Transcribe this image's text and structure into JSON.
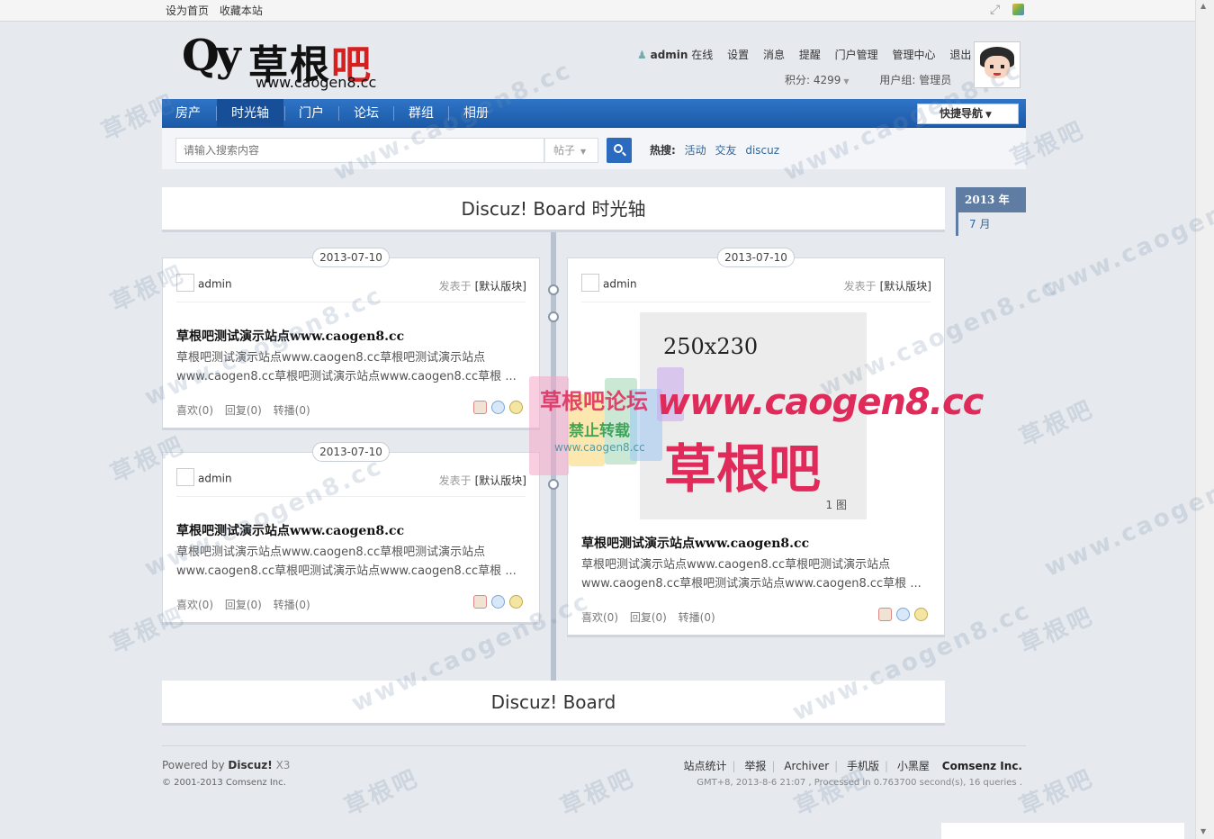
{
  "topbar": {
    "set_home": "设为首页",
    "bookmark": "收藏本站",
    "fullscreen_icon": "fullscreen-icon",
    "app_icon": "app-icon"
  },
  "logo": {
    "script": "Qy",
    "name_left": "草根",
    "name_right": "吧",
    "url": "www.caogen8.cc"
  },
  "user": {
    "name": "admin",
    "status": "在线",
    "settings": "设置",
    "messages": "消息",
    "reminders": "提醒",
    "portal_manage": "门户管理",
    "admin_center": "管理中心",
    "logout": "退出",
    "points": "积分: 4299",
    "group": "用户组: 管理员"
  },
  "nav": {
    "tabs": [
      {
        "label": "房产"
      },
      {
        "label": "时光轴"
      },
      {
        "label": "门户"
      },
      {
        "label": "论坛"
      },
      {
        "label": "群组"
      },
      {
        "label": "相册"
      }
    ],
    "active_index": 1,
    "quick_nav": "快捷导航"
  },
  "search": {
    "placeholder": "请输入搜索内容",
    "type": "帖子",
    "hot_label": "热搜:",
    "hot_keywords": [
      "活动",
      "交友",
      "discuz"
    ]
  },
  "timeline": {
    "title": "Discuz! Board 时光轴",
    "year": "2013 年",
    "month": "7 月",
    "posts": [
      {
        "date": "2013-07-10",
        "author": "admin",
        "posted_in": "发表于",
        "forum": "[默认版块]",
        "title": "草根吧测试演示站点www.caogen8.cc",
        "excerpt": "草根吧测试演示站点www.caogen8.cc草根吧测试演示站点www.caogen8.cc草根吧测试演示站点www.caogen8.cc草根 ...",
        "likes": "喜欢(0)",
        "replies": "回复(0)",
        "forwards": "转播(0)"
      },
      {
        "date": "2013-07-10",
        "author": "admin",
        "posted_in": "发表于",
        "forum": "[默认版块]",
        "title": "草根吧测试演示站点www.caogen8.cc",
        "excerpt": "草根吧测试演示站点www.caogen8.cc草根吧测试演示站点www.caogen8.cc草根吧测试演示站点www.caogen8.cc草根 ...",
        "likes": "喜欢(0)",
        "replies": "回复(0)",
        "forwards": "转播(0)"
      },
      {
        "date": "2013-07-10",
        "author": "admin",
        "posted_in": "发表于",
        "forum": "[默认版块]",
        "image_label": "250x230",
        "image_count": "1 图",
        "title": "草根吧测试演示站点www.caogen8.cc",
        "excerpt": "草根吧测试演示站点www.caogen8.cc草根吧测试演示站点www.caogen8.cc草根吧测试演示站点www.caogen8.cc草根 ...",
        "likes": "喜欢(0)",
        "replies": "回复(0)",
        "forwards": "转播(0)"
      }
    ],
    "bottom_title": "Discuz! Board"
  },
  "footer": {
    "powered_by": "Powered by",
    "product": "Discuz!",
    "version": "X3",
    "copyright": "© 2001-2013 Comsenz Inc.",
    "links": [
      "站点统计",
      "举报",
      "Archiver",
      "手机版",
      "小黑屋"
    ],
    "company": "Comsenz Inc.",
    "time_info": "GMT+8, 2013-8-6 21:07 , Processed in 0.763700 second(s), 16 queries ."
  },
  "watermark": {
    "text_cn": "草根吧",
    "text_url": "www.caogen8.cc",
    "center_line1": "草根吧论坛",
    "center_line2": "禁止转载",
    "center_line3": "www.caogen8.cc",
    "center_url": "www.caogen8.cc",
    "center_big": "草根吧"
  },
  "colors": {
    "nav_blue": "#1b5aa8",
    "accent_red": "#d5201f",
    "link_blue": "#336699"
  }
}
